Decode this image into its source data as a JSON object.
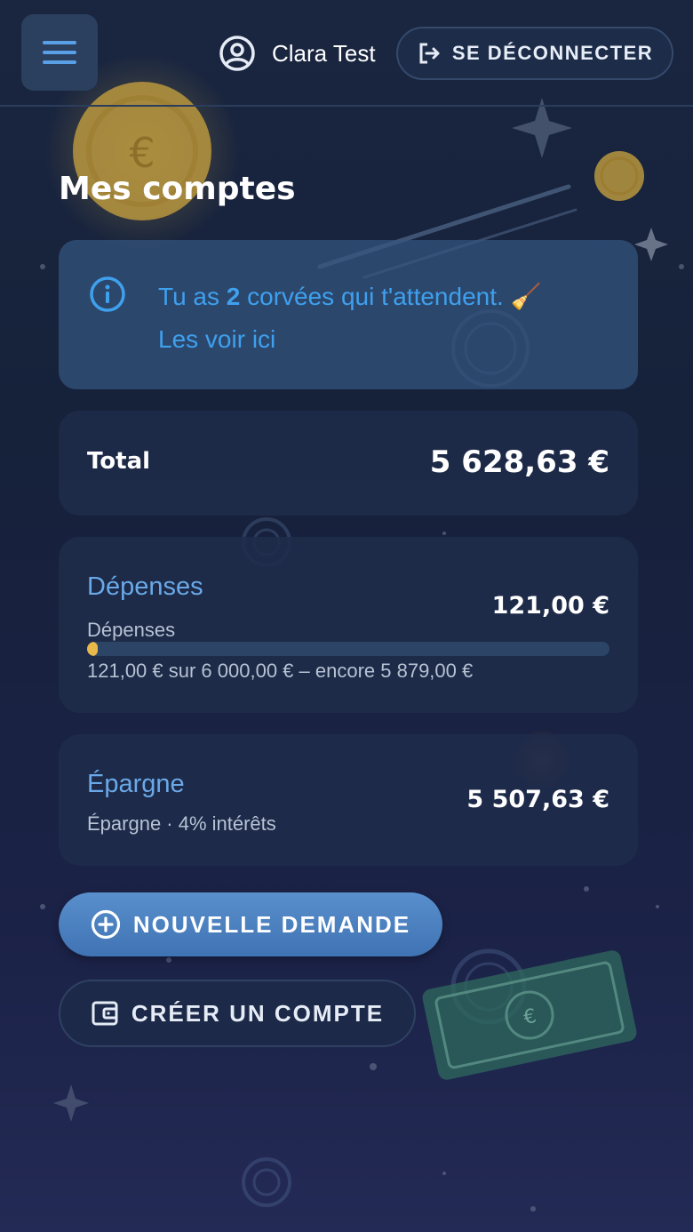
{
  "header": {
    "user_name": "Clara Test",
    "logout_label": "SE DÉCONNECTER"
  },
  "page": {
    "title": "Mes comptes"
  },
  "info": {
    "prefix": "Tu as ",
    "count": "2",
    "suffix": " corvées qui t'attendent. 🧹",
    "link": "Les voir ici"
  },
  "total": {
    "label": "Total",
    "value": "5 628,63 €"
  },
  "accounts": [
    {
      "name": "Dépenses",
      "subtitle": "Dépenses",
      "amount": "121,00 €",
      "progress_fraction": 0.02,
      "progress_text": "121,00 € sur 6 000,00 € – encore 5 879,00 €"
    },
    {
      "name": "Épargne",
      "subtitle": "Épargne · 4% intérêts",
      "amount": "5 507,63 €"
    }
  ],
  "actions": {
    "new_request": "NOUVELLE DEMANDE",
    "create_account": "CRÉER UN COMPTE"
  },
  "colors": {
    "accent": "#3fa0ee",
    "link_blue": "#6aa9e8",
    "progress": "#e8b84a",
    "coin_gold": "#c9a44a"
  },
  "icons": {
    "menu": "hamburger-icon",
    "user": "user-circle-icon",
    "logout": "logout-icon",
    "info": "info-icon",
    "add": "plus-circle-icon",
    "wallet": "wallet-icon"
  }
}
